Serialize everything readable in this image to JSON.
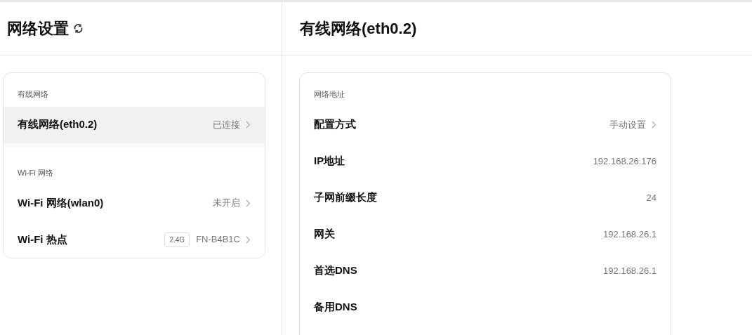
{
  "sidebar": {
    "title": "网络设置",
    "groups": [
      {
        "label": "有线网络",
        "items": [
          {
            "label": "有线网络(eth0.2)",
            "status": "已连接",
            "selected": true
          }
        ]
      },
      {
        "label": "Wi-Fi 网络",
        "items": [
          {
            "label": "Wi-Fi 网络(wlan0)",
            "status": "未开启",
            "selected": false
          },
          {
            "label": "Wi-Fi 热点",
            "badge": "2.4G",
            "status": "FN-B4B1C",
            "selected": false
          }
        ]
      }
    ]
  },
  "detail": {
    "title": "有线网络(eth0.2)",
    "section_label": "网络地址",
    "rows": [
      {
        "kind": "link",
        "label": "配置方式",
        "value": "手动设置"
      },
      {
        "kind": "info",
        "label": "IP地址",
        "value": "192.168.26.176"
      },
      {
        "kind": "info",
        "label": "子网前缀长度",
        "value": "24"
      },
      {
        "kind": "info",
        "label": "网关",
        "value": "192.168.26.1"
      },
      {
        "kind": "info",
        "label": "首选DNS",
        "value": "192.168.26.1"
      },
      {
        "kind": "info",
        "label": "备用DNS"
      }
    ]
  }
}
